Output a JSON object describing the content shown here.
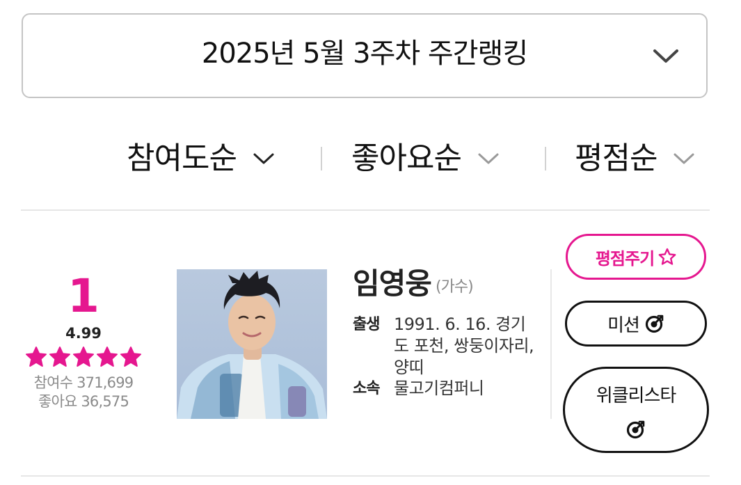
{
  "week_selector": {
    "label": "2025년 5월 3주차 주간랭킹",
    "icon": "chevron-down-icon"
  },
  "sort_tabs": [
    {
      "label": "참여도순",
      "active": true
    },
    {
      "label": "좋아요순",
      "active": false
    },
    {
      "label": "평점순",
      "active": false
    }
  ],
  "ranking_item": {
    "rank": "1",
    "score": "4.99",
    "stars": 5,
    "participants": "참여수 371,699",
    "likes": "좋아요 36,575",
    "name": "임영웅",
    "job": "(가수)",
    "birth_label": "출생",
    "birth_value": "1991. 6. 16. 경기도 포천, 쌍둥이자리, 양띠",
    "agency_label": "소속",
    "agency_value": "물고기컴퍼니",
    "buttons": {
      "rate": "평점주기",
      "mission": "미션",
      "weekly_star": "위클리스타"
    }
  },
  "colors": {
    "accent": "#e5178f",
    "text": "#111111",
    "muted": "#8a8a8a",
    "border": "#c4c4c4"
  }
}
